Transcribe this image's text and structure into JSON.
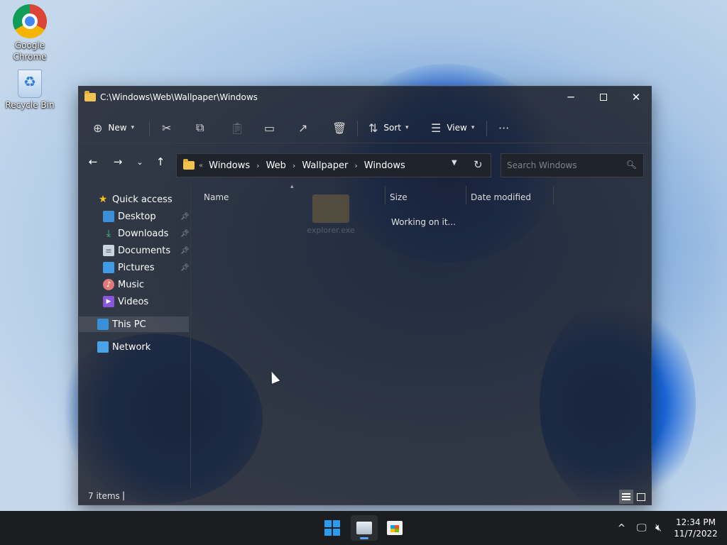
{
  "desktop": {
    "icons": [
      {
        "label_line1": "Google",
        "label_line2": "Chrome",
        "icon": "chrome-icon"
      },
      {
        "label": "Recycle Bin",
        "icon": "recycle-bin-icon"
      }
    ]
  },
  "window": {
    "title": "C:\\Windows\\Web\\Wallpaper\\Windows",
    "controls": {
      "minimize": "─",
      "close": "✕"
    }
  },
  "commandbar": {
    "new_label": "New",
    "sort_label": "Sort",
    "view_label": "View",
    "more_label": "···"
  },
  "address": {
    "more": "«",
    "segments": [
      "Windows",
      "Web",
      "Wallpaper",
      "Windows"
    ],
    "chevron": "›"
  },
  "search": {
    "placeholder": "Search Windows"
  },
  "navpane": {
    "quick_access": "Quick access",
    "items": [
      {
        "label": "Desktop",
        "pinned": true
      },
      {
        "label": "Downloads",
        "pinned": true
      },
      {
        "label": "Documents",
        "pinned": true
      },
      {
        "label": "Pictures",
        "pinned": true
      },
      {
        "label": "Music",
        "pinned": false
      },
      {
        "label": "Videos",
        "pinned": false
      }
    ],
    "this_pc": "This PC",
    "network": "Network"
  },
  "content": {
    "columns": {
      "name": "Name",
      "size": "Size",
      "date_modified": "Date modified"
    },
    "status_message": "Working on it...",
    "ghost_item": "explorer.exe"
  },
  "statusbar": {
    "items_count": "7 items",
    "caret": "|"
  },
  "taskbar": {
    "apps": [
      "start",
      "file-explorer",
      "microsoft-store"
    ],
    "tray_chevron": "^",
    "time": "12:34 PM",
    "date": "11/7/2022"
  },
  "colors": {
    "accent": "#5ea2ff",
    "window_bg": "#1c202a",
    "folder": "#f3c24e"
  }
}
